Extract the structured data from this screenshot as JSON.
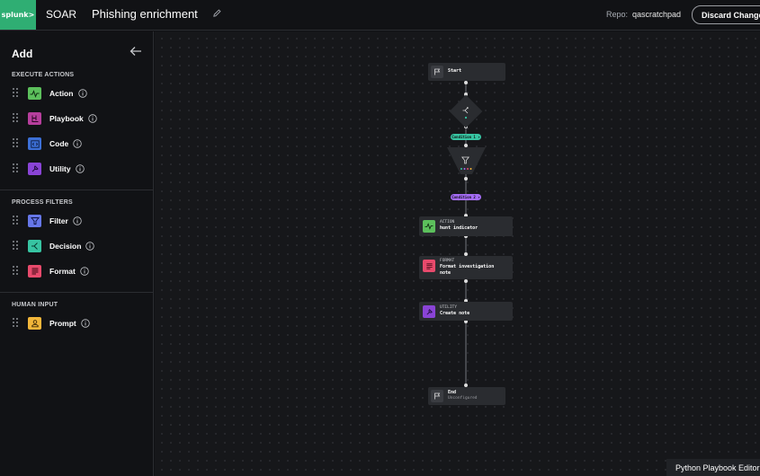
{
  "header": {
    "logo_text": "splunk>",
    "app_name": "SOAR",
    "playbook_title": "Phishing enrichment",
    "repo_label": "Repo:",
    "repo_value": "qascratchpad",
    "discard_label": "Discard Changes"
  },
  "sidebar": {
    "title": "Add",
    "sections": [
      {
        "label": "EXECUTE ACTIONS",
        "items": [
          {
            "label": "Action",
            "icon": "pulse-icon",
            "color": "#5cc05c"
          },
          {
            "label": "Playbook",
            "icon": "playbook-icon",
            "color": "#b63e9c"
          },
          {
            "label": "Code",
            "icon": "code-icon",
            "color": "#3c6fd6"
          },
          {
            "label": "Utility",
            "icon": "utility-icon",
            "color": "#8a44d6"
          }
        ]
      },
      {
        "label": "PROCESS FILTERS",
        "items": [
          {
            "label": "Filter",
            "icon": "filter-icon",
            "color": "#6677e8"
          },
          {
            "label": "Decision",
            "icon": "decision-icon",
            "color": "#37c4a2"
          },
          {
            "label": "Format",
            "icon": "format-icon",
            "color": "#e84a6c"
          }
        ]
      },
      {
        "label": "HUMAN INPUT",
        "items": [
          {
            "label": "Prompt",
            "icon": "prompt-icon",
            "color": "#f2b63a"
          }
        ]
      }
    ]
  },
  "canvas": {
    "start": {
      "label": "Start"
    },
    "condition1": {
      "label": "Condition 1 ▾",
      "color": "#37c4a2"
    },
    "condition2": {
      "label": "Condition 2 ▾",
      "color": "#a46cf5"
    },
    "action": {
      "type": "ACTION",
      "name": "hunt indicator"
    },
    "format": {
      "type": "FORMAT",
      "name_line1": "Format investigation",
      "name_line2": "note"
    },
    "utility": {
      "type": "UTILITY",
      "name": "Create note"
    },
    "end": {
      "label": "End",
      "status": "Unconfigured"
    }
  },
  "footer": {
    "label": "Python Playbook Editor"
  }
}
